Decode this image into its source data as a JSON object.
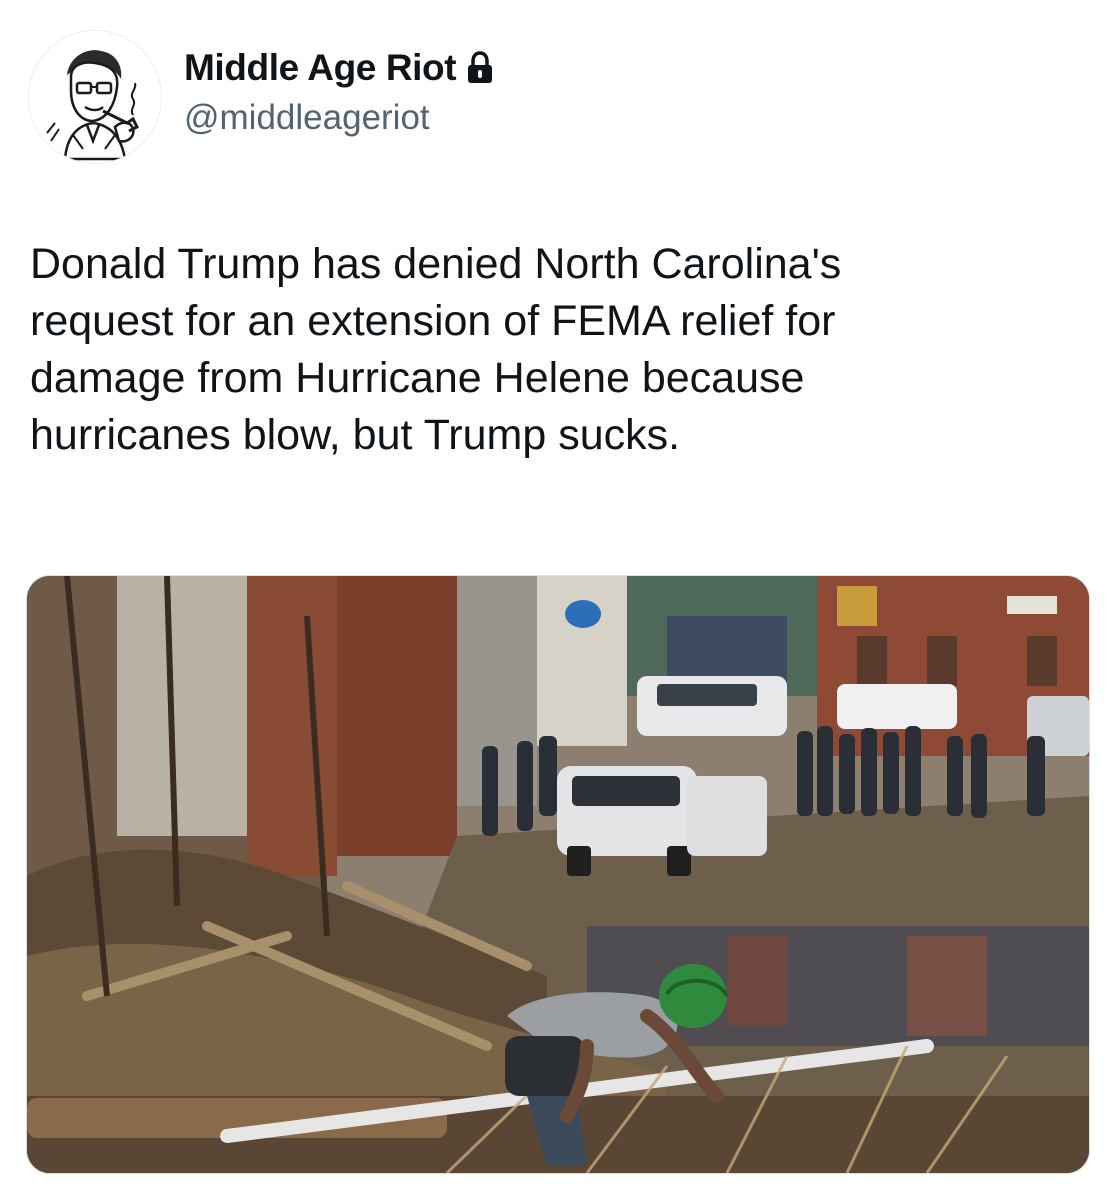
{
  "author": {
    "display_name": "Middle Age Riot",
    "handle": "@middleageriot",
    "avatar_icon": "vintage-man-with-pipe-avatar",
    "badge_icon": "lock-icon"
  },
  "post": {
    "text": "Donald Trump has denied North Carolina's\nrequest for an extension of FEMA relief for\ndamage from Hurricane Helene because\nhurricanes blow, but Trump sucks."
  },
  "media": {
    "type": "photo",
    "icon": "hurricane-damage-street-photo"
  },
  "colors": {
    "text_primary": "#0f1419",
    "text_secondary": "#536471",
    "background": "#ffffff"
  }
}
